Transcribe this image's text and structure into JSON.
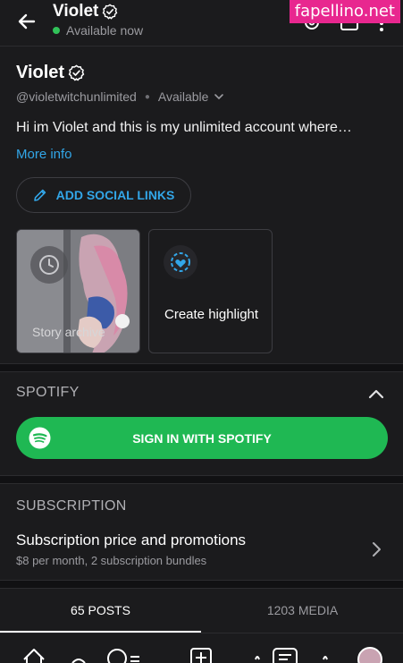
{
  "header": {
    "name": "Violet",
    "status": "Available now",
    "watermark": "fapellino.net"
  },
  "profile": {
    "name": "Violet",
    "handle": "@violetwitchunlimited",
    "availability": "Available",
    "bio": "Hi im Violet and this is my unlimited account where…",
    "more_info": "More info",
    "social_button": "ADD SOCIAL LINKS"
  },
  "stories": {
    "archive_label": "Story archive",
    "highlight_label": "Create highlight"
  },
  "spotify": {
    "section_title": "SPOTIFY",
    "button_label": "SIGN IN WITH SPOTIFY"
  },
  "subscription": {
    "section_title": "SUBSCRIPTION",
    "title": "Subscription price and promotions",
    "description": "$8 per month, 2 subscription bundles"
  },
  "tabs": {
    "posts": "65 POSTS",
    "media": "1203 MEDIA"
  },
  "colors": {
    "accent_blue": "#32a6e8",
    "spotify_green": "#1fb853",
    "online_green": "#31c259",
    "background": "#1b1b1d"
  }
}
